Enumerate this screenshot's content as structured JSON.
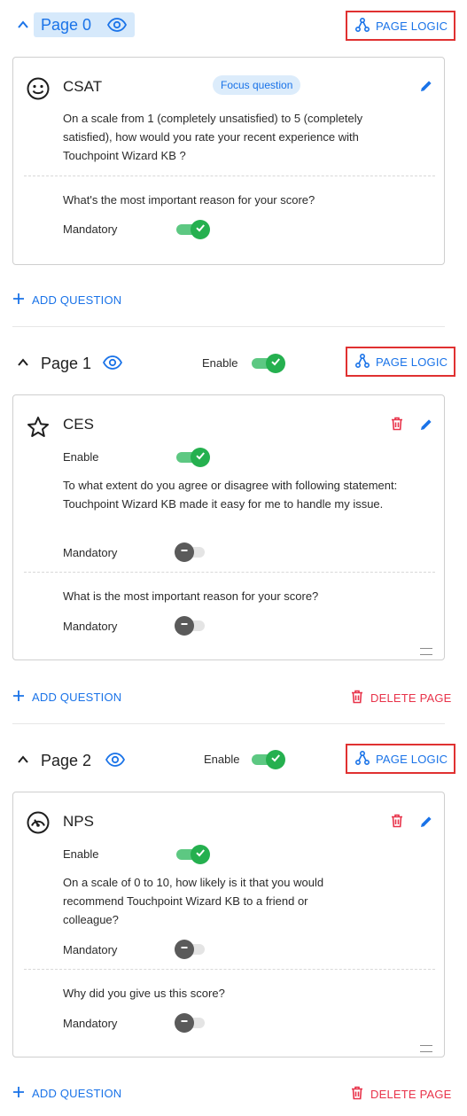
{
  "pages": [
    {
      "title": "Page 0",
      "page_logic_label": "PAGE LOGIC",
      "question": {
        "icon": "smiley-icon",
        "title": "CSAT",
        "badge": "Focus question",
        "text": "On a scale from 1 (completely unsatisfied) to 5 (completely satisfied), how would you rate your recent experience with Touchpoint Wizard KB ?",
        "follow_up": "What's the most important reason for your score?",
        "mandatory_label": "Mandatory",
        "mandatory_on": true
      },
      "add_question_label": "ADD QUESTION"
    },
    {
      "title": "Page 1",
      "enable_label": "Enable",
      "enable_on": true,
      "page_logic_label": "PAGE LOGIC",
      "question": {
        "icon": "star-icon",
        "title": "CES",
        "enable_label": "Enable",
        "enable_on": true,
        "text": "To what extent do you agree or disagree with following statement: Touchpoint Wizard KB made it easy for me to handle my issue.",
        "mandatory_label": "Mandatory",
        "mandatory_on": false,
        "follow_up": "What is the most important reason for your score?",
        "follow_mandatory_label": "Mandatory",
        "follow_mandatory_on": false
      },
      "add_question_label": "ADD QUESTION",
      "delete_page_label": "DELETE PAGE"
    },
    {
      "title": "Page 2",
      "enable_label": "Enable",
      "enable_on": true,
      "page_logic_label": "PAGE LOGIC",
      "question": {
        "icon": "gauge-icon",
        "title": "NPS",
        "enable_label": "Enable",
        "enable_on": true,
        "text": "On a scale of 0 to 10, how likely is it that you would recommend Touchpoint Wizard KB to a friend or colleague?",
        "mandatory_label": "Mandatory",
        "mandatory_on": false,
        "follow_up": "Why did you give us this score?",
        "follow_mandatory_label": "Mandatory",
        "follow_mandatory_on": false
      },
      "add_question_label": "ADD QUESTION",
      "delete_page_label": "DELETE PAGE"
    }
  ],
  "colors": {
    "accent": "#1a73e8",
    "danger": "#e8334a",
    "toggle_on": "#25b04f",
    "toggle_off": "#5a5a5a",
    "highlight_border": "#e03131"
  }
}
